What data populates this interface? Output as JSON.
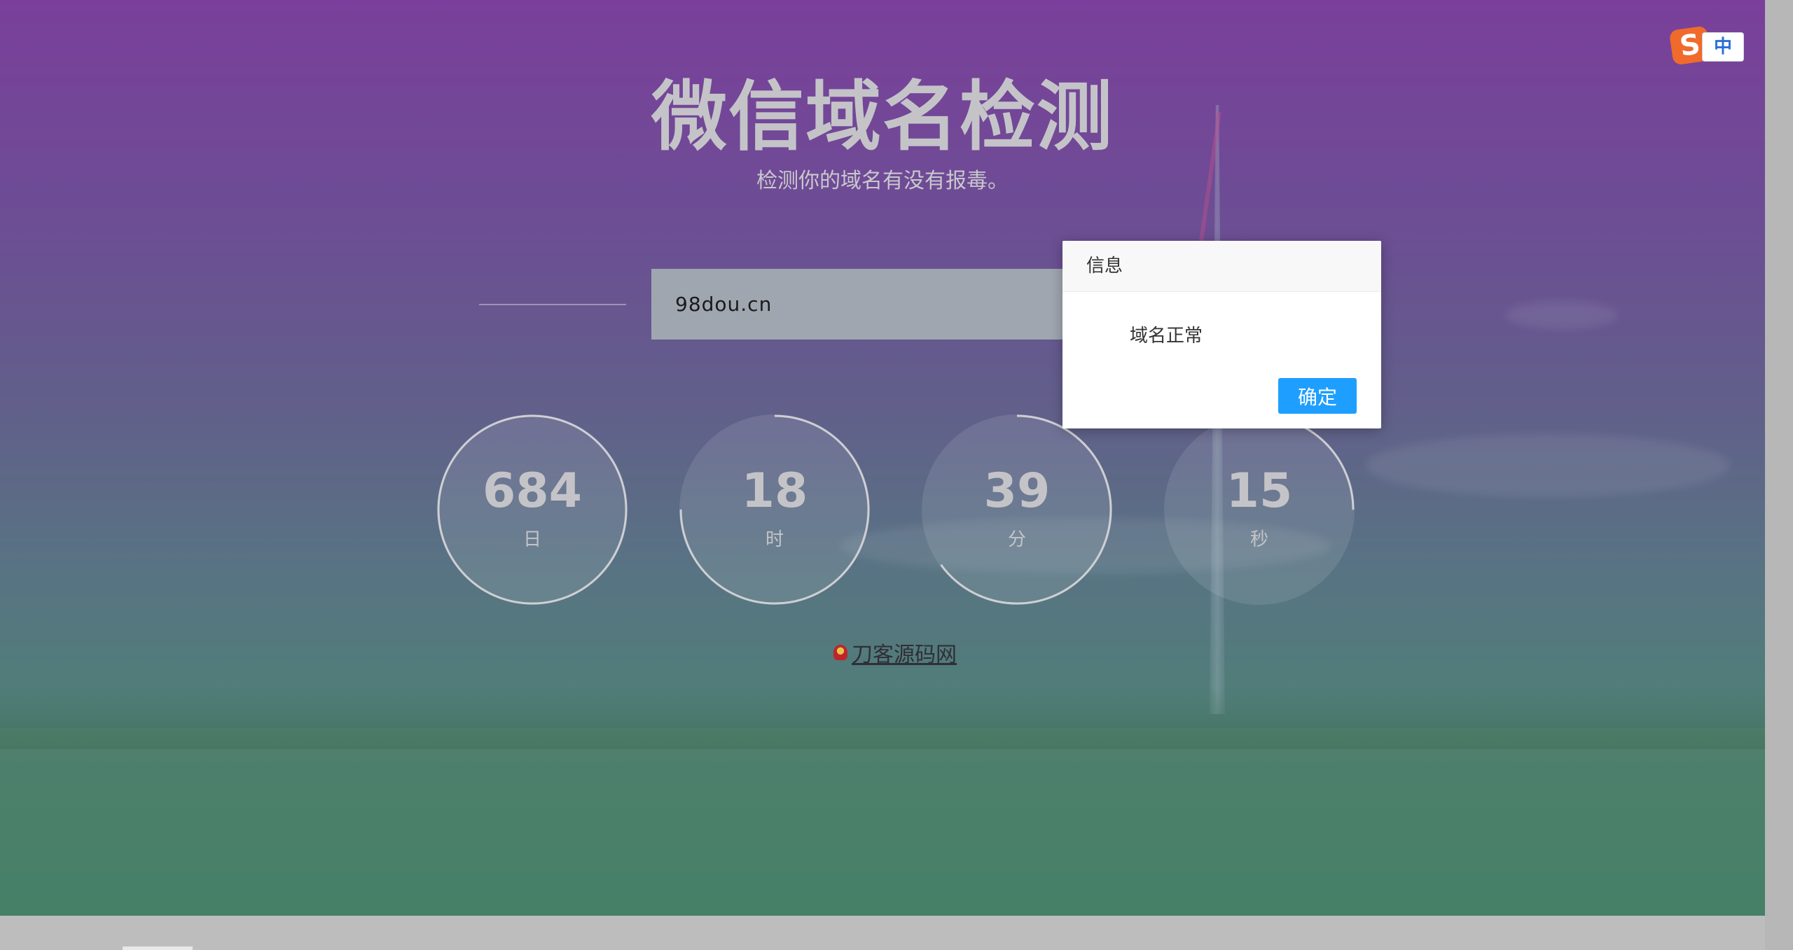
{
  "header": {
    "title": "微信域名检测",
    "subtitle": "检测你的域名有没有报毒。"
  },
  "search": {
    "value": "98dou.cn"
  },
  "countdown": [
    {
      "value": "684",
      "unit": "日",
      "progress": 1.0
    },
    {
      "value": "18",
      "unit": "时",
      "progress": 0.75
    },
    {
      "value": "39",
      "unit": "分",
      "progress": 0.65
    },
    {
      "value": "15",
      "unit": "秒",
      "progress": 0.25
    }
  ],
  "footer": {
    "link_text": "刀客源码网"
  },
  "dialog": {
    "title": "信息",
    "message": "域名正常",
    "confirm_label": "确定"
  },
  "ime": {
    "logo": "S",
    "mode": "中"
  },
  "colors": {
    "accent": "#1e9fff",
    "gradient_top": "#7a3f9b",
    "gradient_bottom": "#447e6a"
  }
}
